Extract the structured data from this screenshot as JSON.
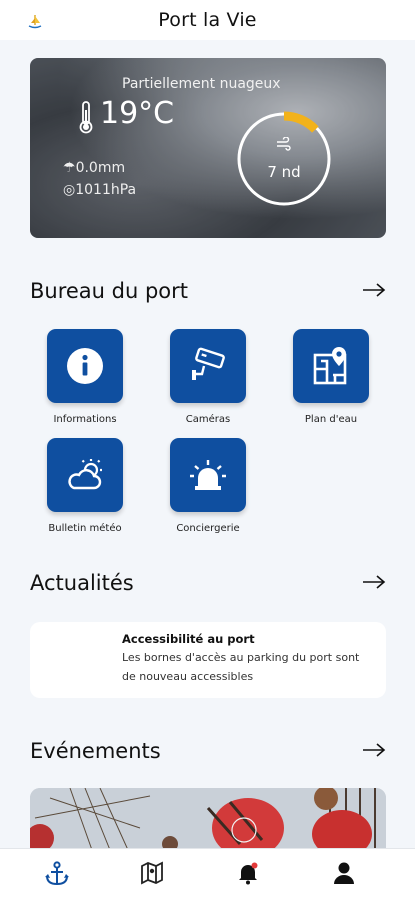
{
  "header": {
    "title": "Port la Vie"
  },
  "weather": {
    "condition": "Partiellement nuageux",
    "temperature": "19°C",
    "rain": "0.0mm",
    "pressure": "1011hPa",
    "wind": "7 nd",
    "wind_gauge_fraction": 0.13
  },
  "sections": {
    "bureau": "Bureau du port",
    "news": "Actualités",
    "events": "Evénements"
  },
  "tiles": [
    {
      "label": "Informations",
      "icon": "info-icon"
    },
    {
      "label": "Caméras",
      "icon": "camera-icon"
    },
    {
      "label": "Plan d'eau",
      "icon": "map-pin-icon"
    },
    {
      "label": "Bulletin météo",
      "icon": "weather-icon"
    },
    {
      "label": "Conciergerie",
      "icon": "siren-icon"
    }
  ],
  "news": {
    "title": "Accessibilité au port",
    "body": "Les bornes d'accès au parking du port sont de nouveau accessibles"
  },
  "navbar": {
    "items": [
      "anchor-icon",
      "map-icon",
      "bell-icon",
      "user-icon"
    ],
    "active_color": "#0f4fa0"
  },
  "colors": {
    "accent": "#0f4fa0",
    "gauge": "#f2b21b"
  }
}
